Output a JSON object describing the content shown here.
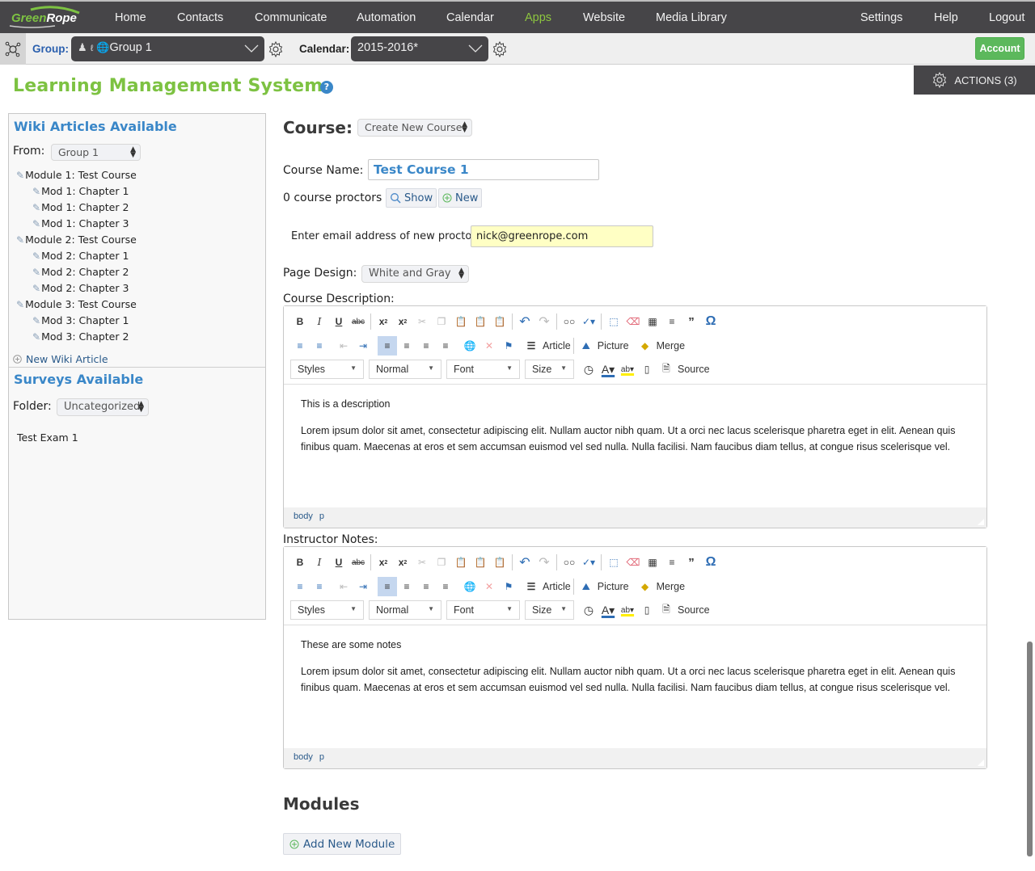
{
  "nav": {
    "logo": {
      "part1": "Green",
      "part2": "Rope"
    },
    "items": [
      {
        "label": "Home",
        "active": false
      },
      {
        "label": "Contacts",
        "active": false
      },
      {
        "label": "Communicate",
        "active": false
      },
      {
        "label": "Automation",
        "active": false
      },
      {
        "label": "Calendar",
        "active": false
      },
      {
        "label": "Apps",
        "active": true
      },
      {
        "label": "Website",
        "active": false
      },
      {
        "label": "Media Library",
        "active": false
      }
    ],
    "right_items": [
      {
        "label": "Settings"
      },
      {
        "label": "Help"
      },
      {
        "label": "Logout"
      }
    ]
  },
  "subbar": {
    "group_label": "Group:",
    "group_value": "Group 1",
    "calendar_label": "Calendar:",
    "calendar_value": "2015-2016*",
    "account_label": "Account"
  },
  "actions": {
    "label": "ACTIONS (3)"
  },
  "page": {
    "title": "Learning Management System",
    "help_icon": "?"
  },
  "wiki": {
    "heading": "Wiki Articles Available",
    "from_label": "From:",
    "from_value": "Group 1",
    "items": [
      {
        "label": "Module 1: Test Course",
        "level": 0
      },
      {
        "label": "Mod 1: Chapter 1",
        "level": 1
      },
      {
        "label": "Mod 1: Chapter 2",
        "level": 1
      },
      {
        "label": "Mod 1: Chapter 3",
        "level": 1
      },
      {
        "label": "Module 2: Test Course",
        "level": 0
      },
      {
        "label": "Mod 2: Chapter 1",
        "level": 1
      },
      {
        "label": "Mod 2: Chapter 2",
        "level": 1
      },
      {
        "label": "Mod 2: Chapter 3",
        "level": 1
      },
      {
        "label": "Module 3: Test Course",
        "level": 0
      },
      {
        "label": "Mod 3: Chapter 1",
        "level": 1
      },
      {
        "label": "Mod 3: Chapter 2",
        "level": 1
      }
    ],
    "new_article": "New Wiki Article"
  },
  "surveys": {
    "heading": "Surveys Available",
    "folder_label": "Folder:",
    "folder_value": "Uncategorized",
    "items": [
      "Test Exam 1"
    ]
  },
  "course": {
    "label": "Course:",
    "select_value": "Create New Course",
    "name_label": "Course Name:",
    "name_value": "Test Course 1",
    "proctors_text": "0 course proctors",
    "show_label": "Show",
    "new_label": "New",
    "email_label": "Enter email address of new proctor:",
    "email_value": "nick@greenrope.com",
    "design_label": "Page Design:",
    "design_value": "White and Gray",
    "description_label": "Course Description:",
    "notes_label": "Instructor Notes:"
  },
  "editor_toolbar": {
    "article": "Article",
    "picture": "Picture",
    "merge": "Merge",
    "styles": "Styles",
    "format": "Normal",
    "font": "Font",
    "size": "Size",
    "source": "Source"
  },
  "description_editor": {
    "paragraphs": [
      "This is a description",
      "Lorem ipsum dolor sit amet, consectetur adipiscing elit. Nullam auctor nibh quam. Ut a orci nec lacus scelerisque pharetra eget in elit. Aenean quis finibus quam. Maecenas at eros et sem accumsan euismod vel sed nulla. Nulla facilisi. Nam faucibus diam tellus, at congue risus scelerisque vel."
    ],
    "path": [
      "body",
      "p"
    ]
  },
  "notes_editor": {
    "paragraphs": [
      "These are some notes",
      "Lorem ipsum dolor sit amet, consectetur adipiscing elit. Nullam auctor nibh quam. Ut a orci nec lacus scelerisque pharetra eget in elit. Aenean quis finibus quam. Maecenas at eros et sem accumsan euismod vel sed nulla. Nulla facilisi. Nam faucibus diam tellus, at congue risus scelerisque vel."
    ],
    "path": [
      "body",
      "p"
    ]
  },
  "modules": {
    "heading": "Modules",
    "add_label": "Add New Module"
  },
  "colors": {
    "brand_green": "#7dc242",
    "nav_bg": "#464548",
    "link_blue": "#3a87c8",
    "account_green": "#5cb85c",
    "email_highlight": "#ffffc4"
  }
}
